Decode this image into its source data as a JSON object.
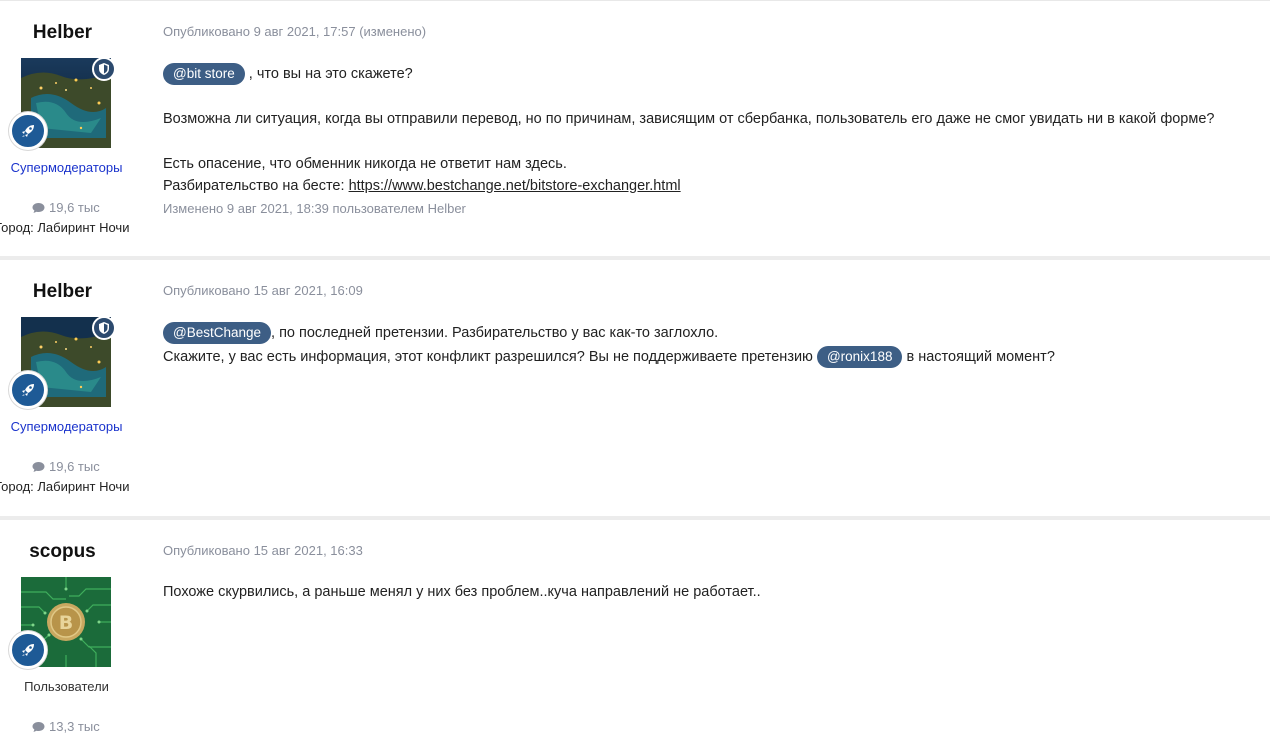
{
  "posts": [
    {
      "author": "Helber",
      "group": "Супермодераторы",
      "posts_count": "19,6 тыс",
      "city": "Город: Лабиринт Ночи",
      "meta": "Опубликовано 9 авг 2021, 17:57 (изменено)",
      "mention1": "@bit store",
      "line1_rest": " , что вы на это скажете?",
      "line2": "Возможна ли ситуация, когда вы отправили перевод, но по причинам, зависящим от сбербанка, пользователь  его даже не смог увидать ни  в какой форме?",
      "line3": "Есть опасение, что обменник никогда не ответит нам здесь.",
      "line4_prefix": "Разбирательство на бесте: ",
      "link": "https://www.bestchange.net/bitstore-exchanger.html",
      "edited": "Изменено 9 авг 2021, 18:39 пользователем Helber"
    },
    {
      "author": "Helber",
      "group": "Супермодераторы",
      "posts_count": "19,6 тыс",
      "city": "Город: Лабиринт Ночи",
      "meta": "Опубликовано 15 авг 2021, 16:09",
      "mention1": "@BestChange",
      "line1_rest": ", по последней претензии. Разбирательство у вас как-то заглохло.",
      "line2_prefix": "Скажите, у вас есть информация, этот конфликт разрешился? Вы не поддерживаете претензию ",
      "mention2": "@ronix188",
      "line2_suffix": "  в настоящий момент?"
    },
    {
      "author": "scopus",
      "group": "Пользователи",
      "posts_count": "13,3 тыс",
      "meta": "Опубликовано 15 авг 2021, 16:33",
      "line1": "Похоже скурвились, а раньше менял у них без проблем..куча направлений не работает.."
    }
  ],
  "colors": {
    "mention_bg": "#3d5e85",
    "moderator_group": "#1a33cc",
    "meta_text": "#8a8f9c",
    "rank_badge": "#1e5a96"
  },
  "icons": {
    "rank": "rocket-icon",
    "moderator": "shield-icon",
    "posts": "comment-icon"
  }
}
